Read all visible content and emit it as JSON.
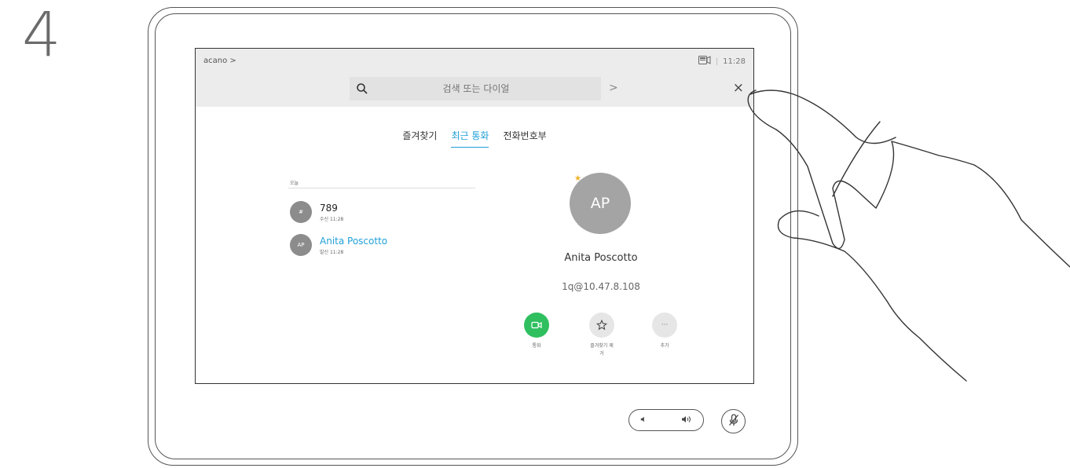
{
  "step": {
    "number": "4"
  },
  "topbar": {
    "breadcrumb": "acano >",
    "time": "11:28",
    "separator": "|"
  },
  "search": {
    "placeholder": "검색 또는 다이얼",
    "next_label": ">",
    "close_label": "×"
  },
  "tabs": [
    {
      "label": "즐겨찾기"
    },
    {
      "label": "최근 통화"
    },
    {
      "label": "전화번호부"
    }
  ],
  "recent": {
    "section_header": "오늘",
    "items": [
      {
        "initials": "#",
        "title": "789",
        "subtitle": "수신 11:28"
      },
      {
        "initials": "AP",
        "title": "Anita Poscotto",
        "subtitle": "발신 11:28"
      }
    ]
  },
  "detail": {
    "initials": "AP",
    "name": "Anita Poscotto",
    "address": "1q@10.47.8.108",
    "actions": [
      {
        "label": "통화"
      },
      {
        "label": "즐겨찾기 제\n거"
      },
      {
        "label": "추가"
      }
    ]
  },
  "controls": {
    "more_glyph": "···"
  },
  "colors": {
    "accent": "#21a0d8",
    "call_green": "#2fbf5f",
    "star": "#f0b12a"
  }
}
